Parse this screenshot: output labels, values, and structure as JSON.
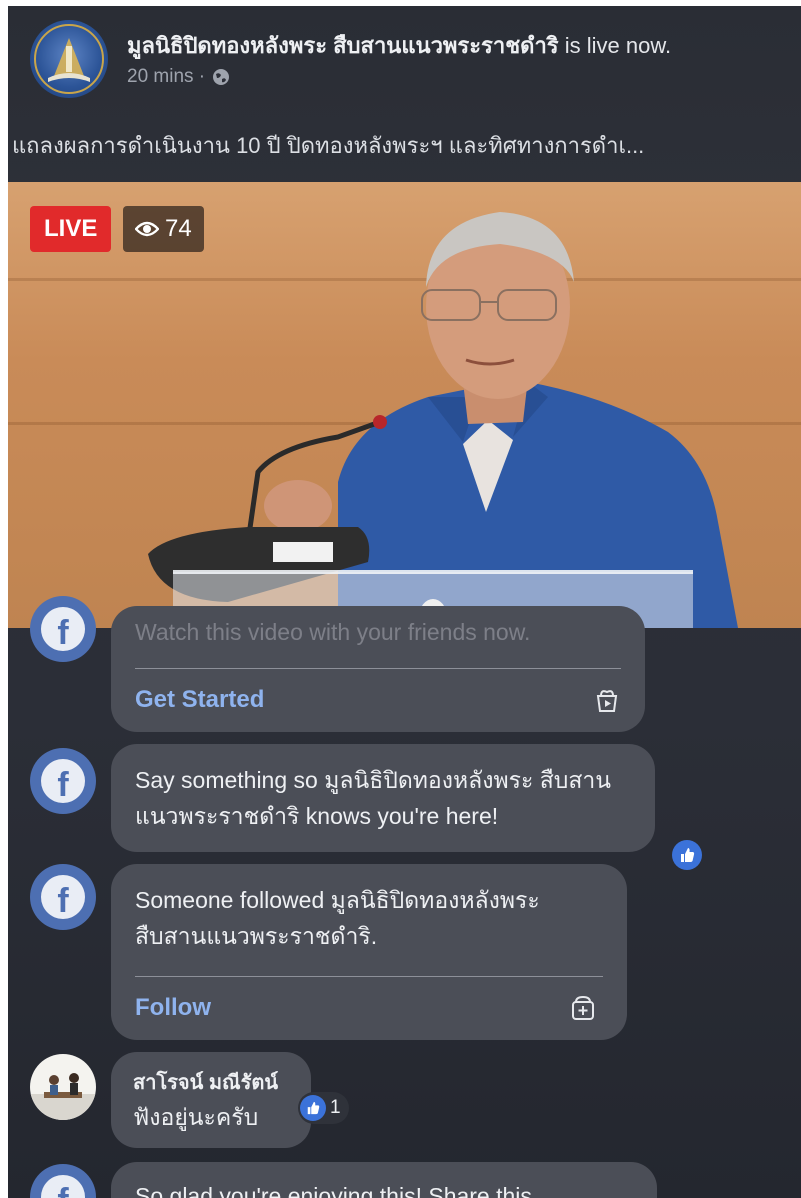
{
  "post": {
    "page_name": "มูลนิธิปิดทองหลังพระ สืบสานแนวพระราชดำริ",
    "status_suffix": " is live now.",
    "time": "20 mins · ",
    "description": "แถลงผลการดำเนินงาน 10 ปี ปิดทองหลังพระฯ และทิศทางการดำเ..."
  },
  "video": {
    "live_label": "LIVE",
    "viewer_count": "74"
  },
  "comments": {
    "partial_text": "Watch this video with your friends now.",
    "get_started": "Get Started",
    "say_something": "Say something so มูลนิธิปิดทองหลังพระ สืบสานแนวพระราชดำริ knows you're here!",
    "followed_text": "Someone followed มูลนิธิปิดทองหลังพระ สืบสานแนวพระราชดำริ.",
    "follow_label": "Follow",
    "user_comment": {
      "author": "สาโรจน์ มณีรัตน์",
      "text": "ฟังอยู่นะครับ",
      "like_count": "1"
    },
    "bottom_text": "So glad you're enjoying this! Share this"
  },
  "colors": {
    "live_red": "#e12a2b",
    "fb_blue": "#4d6fb2",
    "link_blue": "#8fb3ee",
    "card_bg": "#4b4e57"
  },
  "icons": [
    "globe-icon",
    "eye-icon",
    "facebook-icon",
    "gift-box-icon",
    "add-box-icon",
    "like-icon"
  ]
}
